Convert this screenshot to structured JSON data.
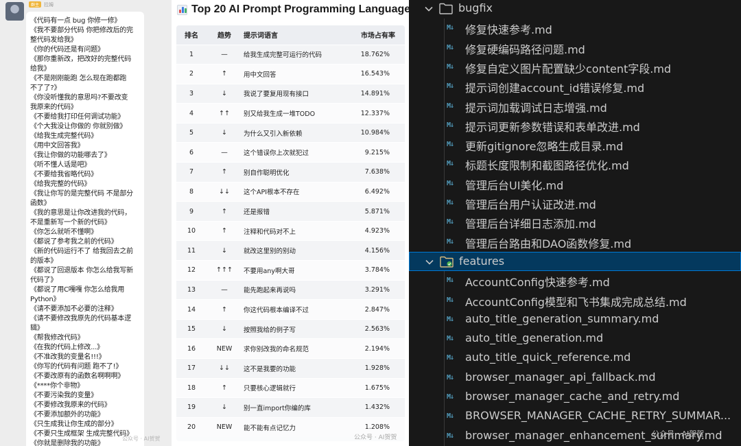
{
  "chat": {
    "sender_tag": "群主",
    "sender_name": "拉姆",
    "messages": [
      "《代码有一点 bug 你修一修》",
      "《我不要部分代码 你把修改后的完",
      "整代码发给我》",
      "《你的代码还是有问题》",
      "《那你重新改，把改好的完整代码",
      "给我》",
      "《不是刚刚能跑 怎么现在跑都跑",
      "不了了?》",
      "《你没听懂我的意思吗?不要改变",
      "我原来的代码》",
      "《不要给我打印任何调试功能》",
      "《个大我没让你做的 你就别做》",
      "《给我生成完整代码》",
      "《用中文回答我》",
      "《我让你做的功能哪去了》",
      "《听不懂人话是吧》",
      "《不要给我省略代码》",
      "《给我完整的代码》",
      "《我让你写的是完整代码 不是部分",
      "函数》",
      "《我的意思是让你改进我的代码，",
      "不是重新写一个新的代码》",
      "《你怎么就听不懂啊》",
      "《都说了参考我之前的代码》",
      "《新的代码运行不了 给我回去之前",
      "的版本》",
      "《都说了回退版本 你怎么给我写新",
      "代码了》",
      "《都说了用C嘎嘎 你怎么给我用",
      "Python》",
      "《请不要添加不必要的注释》",
      "《请不要修改我原先的代码基本逻",
      "辑》",
      "《帮我修改代码》",
      "《在我的代码上修改...》",
      "《不准改我的变量名!!!》",
      "《你写的代码有问题 跑不了!》",
      "《不要改原有的函数名啊啊啊》",
      "《****你个非物》",
      "《不要污染我的变量》",
      "《不要修改我原来的代码》",
      "《不要添加额外的功能》",
      "《只生成我让你生成的部分》",
      "《不要只生成框架 生成完整代码》",
      "《你就是删除我的功能》"
    ]
  },
  "watermark": "公众号 · AI贺贺",
  "ranking": {
    "title": "Top 20 AI Prompt Programming Languages",
    "columns": [
      "排名",
      "趋势",
      "提示词语言",
      "市场占有率"
    ],
    "rows": [
      {
        "rank": "1",
        "trend": "—",
        "text": "给我生成完整可运行的代码",
        "share": "18.762%"
      },
      {
        "rank": "2",
        "trend": "↑",
        "text": "用中文回答",
        "share": "16.543%"
      },
      {
        "rank": "3",
        "trend": "↓",
        "text": "我说了要复用现有接口",
        "share": "14.891%"
      },
      {
        "rank": "4",
        "trend": "↑↑",
        "text": "别又给我生成一堆TODO",
        "share": "12.337%"
      },
      {
        "rank": "5",
        "trend": "↓",
        "text": "为什么又引入新依赖",
        "share": "10.984%"
      },
      {
        "rank": "6",
        "trend": "—",
        "text": "这个错误你上次就犯过",
        "share": "9.215%"
      },
      {
        "rank": "7",
        "trend": "↑",
        "text": "别自作聪明优化",
        "share": "7.638%"
      },
      {
        "rank": "8",
        "trend": "↓↓",
        "text": "这个API根本不存在",
        "share": "6.492%"
      },
      {
        "rank": "9",
        "trend": "↑",
        "text": "还是报错",
        "share": "5.871%"
      },
      {
        "rank": "10",
        "trend": "↑",
        "text": "注释和代码对不上",
        "share": "4.923%"
      },
      {
        "rank": "11",
        "trend": "↓",
        "text": "就改这里别的别动",
        "share": "4.156%"
      },
      {
        "rank": "12",
        "trend": "↑↑↑",
        "text": "不要用any啊大哥",
        "share": "3.784%"
      },
      {
        "rank": "13",
        "trend": "—",
        "text": "能先跑起来再说吗",
        "share": "3.291%"
      },
      {
        "rank": "14",
        "trend": "↑",
        "text": "你这代码根本编译不过",
        "share": "2.847%"
      },
      {
        "rank": "15",
        "trend": "↓",
        "text": "按照我给的例子写",
        "share": "2.563%"
      },
      {
        "rank": "16",
        "trend": "NEW",
        "text": "求你别改我的命名规范",
        "share": "2.194%"
      },
      {
        "rank": "17",
        "trend": "↓↓",
        "text": "这不是我要的功能",
        "share": "1.928%"
      },
      {
        "rank": "18",
        "trend": "↑",
        "text": "只要核心逻辑就行",
        "share": "1.675%"
      },
      {
        "rank": "19",
        "trend": "↓",
        "text": "别一直import你编的库",
        "share": "1.432%"
      },
      {
        "rank": "20",
        "trend": "NEW",
        "text": "能不能有点记忆力",
        "share": "1.208%"
      }
    ]
  },
  "explorer": {
    "md_badge": "M↓",
    "folder_color": "#c5c5c5",
    "accent": "#0078d4",
    "folders": [
      {
        "name": "bugfix",
        "files": [
          "修复快速参考.md",
          "修复硬编码路径问题.md",
          "修复自定义图片配置缺少content字段.md",
          "提示词创建account_id错误修复.md",
          "提示词加载调试日志增强.md",
          "提示词更新参数错误和表单改进.md",
          "更新gitignore忽略生成目录.md",
          "标题长度限制和截图路径优化.md",
          "管理后台UI美化.md",
          "管理后台用户认证改进.md",
          "管理后台详细日志添加.md",
          "管理后台路由和DAO函数修复.md"
        ]
      },
      {
        "name": "features",
        "files": [
          "AccountConfig快速参考.md",
          "AccountConfig模型和飞书集成完成总结.md",
          "auto_title_generation_summary.md",
          "auto_title_generation.md",
          "auto_title_quick_reference.md",
          "browser_manager_api_fallback.md",
          "browser_manager_cache_and_retry.md",
          "BROWSER_MANAGER_CACHE_RETRY_SUMMAR...",
          "browser_manager_enhancement_summary.md"
        ]
      }
    ]
  }
}
